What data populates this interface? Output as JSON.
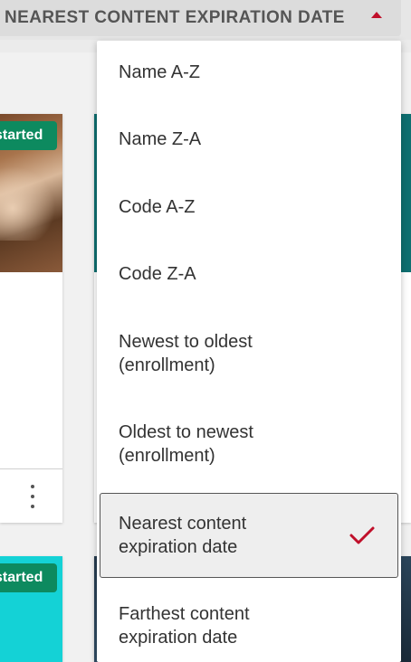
{
  "sort": {
    "current_label": "NEAREST CONTENT EXPIRATION DATE",
    "caret_icon": "caret-up-icon",
    "accent_color": "#c00f2a",
    "options": [
      {
        "label": "Name A-Z",
        "selected": false
      },
      {
        "label": "Name Z-A",
        "selected": false
      },
      {
        "label": "Code A-Z",
        "selected": false
      },
      {
        "label": "Code Z-A",
        "selected": false
      },
      {
        "label": "Newest to oldest (enrollment)",
        "selected": false
      },
      {
        "label": "Oldest to newest (enrollment)",
        "selected": false
      },
      {
        "label": "Nearest content expiration date",
        "selected": true
      },
      {
        "label": "Farthest content expiration date",
        "selected": false
      }
    ],
    "selected_icon": "checkmark-icon"
  },
  "cards": {
    "badge_text_1": "started",
    "badge_text_2": "started",
    "badge_color": "#0d8a5f",
    "more_icon": "kebab-menu-icon"
  }
}
